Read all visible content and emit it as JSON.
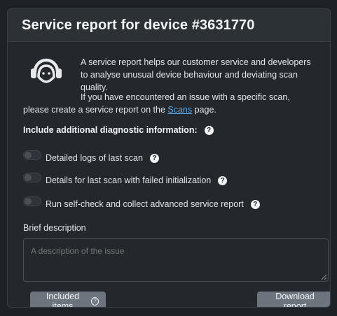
{
  "header": {
    "title": "Service report for device #3631770"
  },
  "intro": {
    "paragraph1": "A service report helps our customer service and developers to analyse unusual device behaviour and deviating scan quality.",
    "paragraph2_before": "If you have encountered an issue with a specific scan, please create a service report on the ",
    "paragraph2_link": "Scans",
    "paragraph2_after": " page."
  },
  "diagnostics": {
    "heading": "Include additional diagnostic information:",
    "help_glyph": "?",
    "options": [
      {
        "label": "Detailed logs of last scan",
        "enabled": false
      },
      {
        "label": "Details for last scan with failed initialization",
        "enabled": false
      },
      {
        "label": "Run self-check and collect advanced service report",
        "enabled": false
      }
    ]
  },
  "description": {
    "label": "Brief description",
    "placeholder": "A description of the issue"
  },
  "buttons": {
    "included_items": "Included items",
    "download_report": "Download report"
  },
  "icons": {
    "support": "headset-support-icon",
    "help": "question-circle-icon"
  },
  "colors": {
    "background": "#1e2125",
    "panel": "#24282c",
    "header": "#2c3136",
    "button": "#6c757d",
    "link": "#5aa7e8"
  }
}
